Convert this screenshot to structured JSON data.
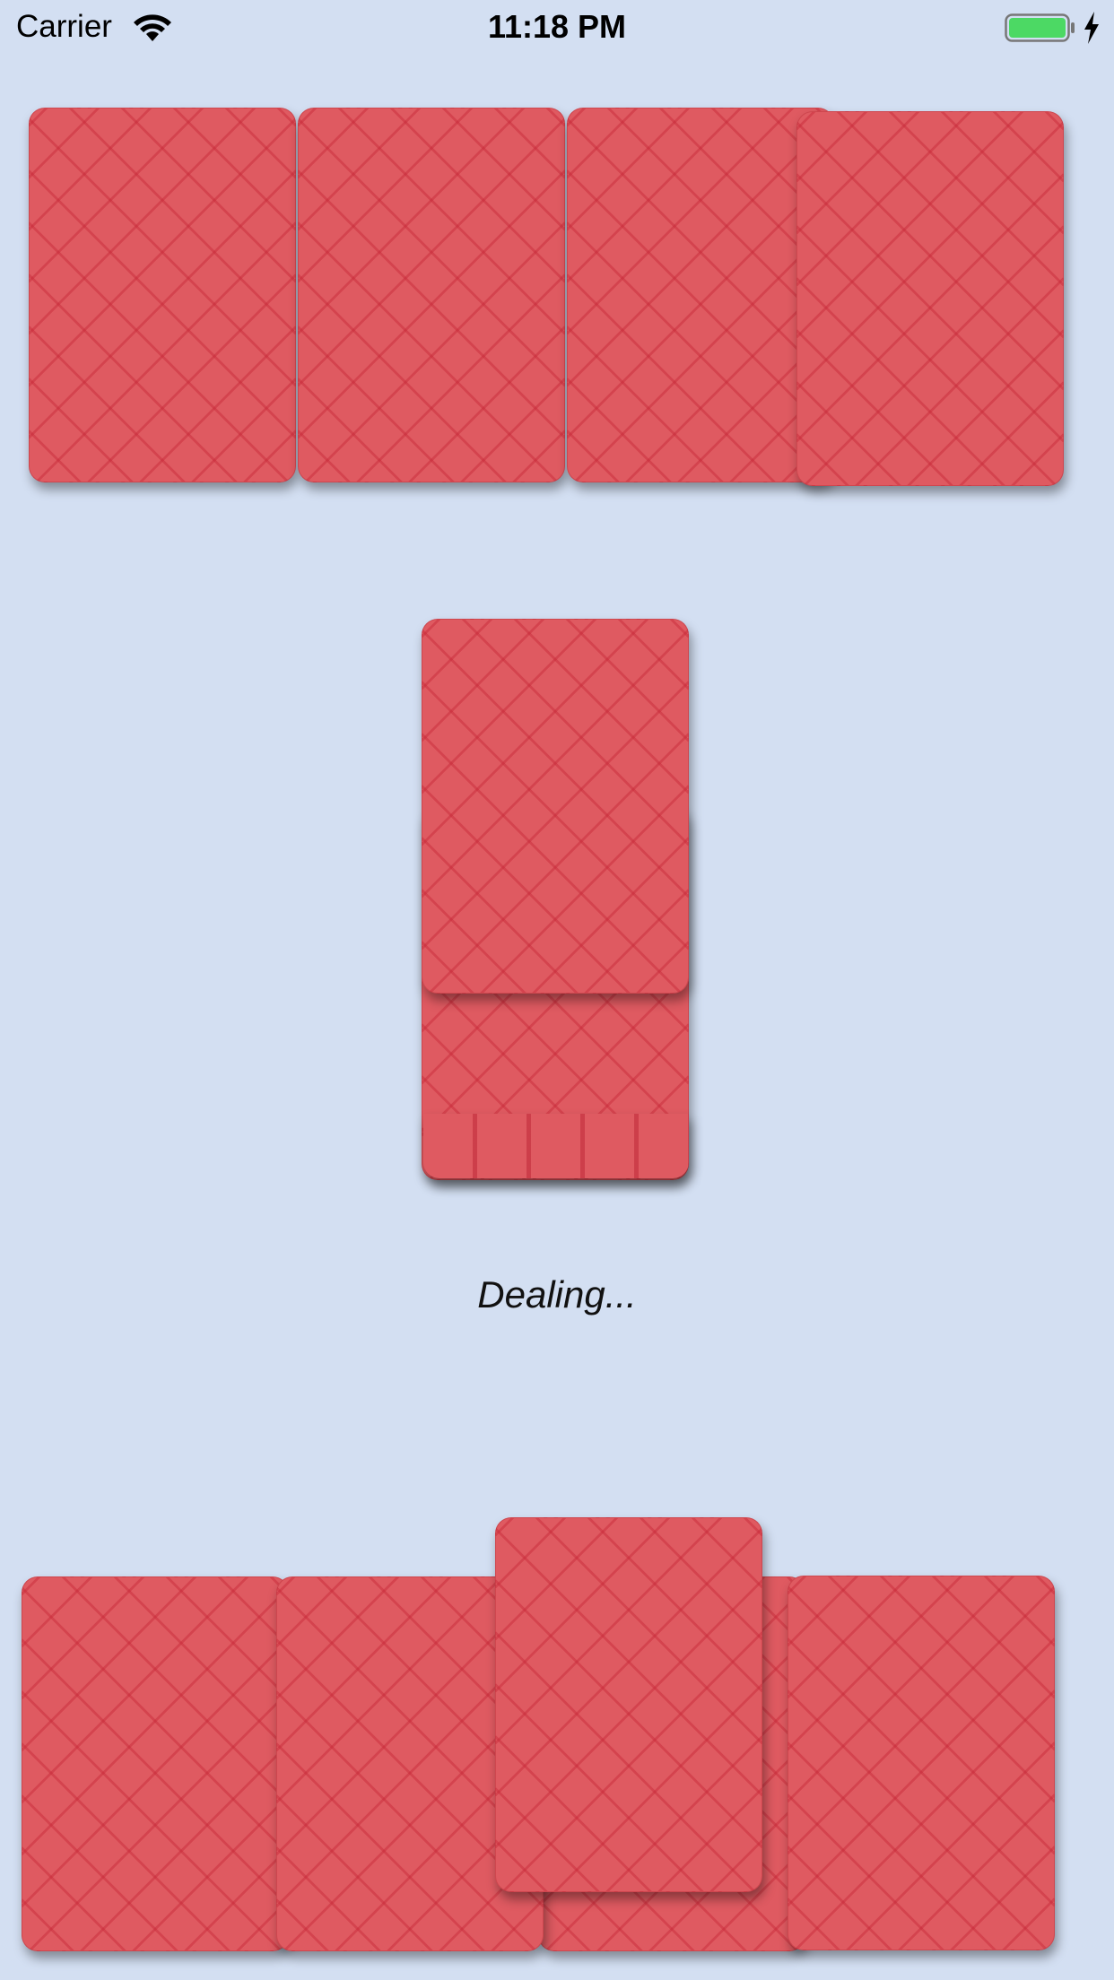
{
  "status_bar": {
    "carrier": "Carrier",
    "time": "11:18 PM",
    "battery_color": "#4cd964"
  },
  "table": {
    "background_color": "#d3dff2",
    "card_back_color": "#df5a61",
    "opponent_hand": {
      "card_count": 4,
      "face": "down"
    },
    "deck": {
      "face": "down"
    },
    "player_hand": {
      "card_count": 5,
      "face": "down"
    }
  },
  "status_message": "Dealing..."
}
